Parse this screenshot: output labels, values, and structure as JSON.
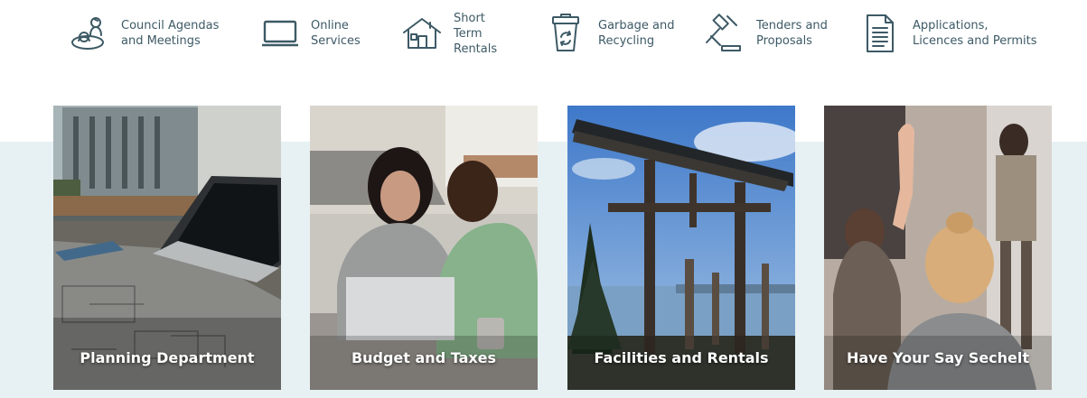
{
  "quick_links": [
    {
      "label": "Council Agendas\nand Meetings",
      "icon": "council-icon"
    },
    {
      "label": "Online\nServices",
      "icon": "laptop-icon"
    },
    {
      "label": "Short\nTerm\nRentals",
      "icon": "house-icon"
    },
    {
      "label": "Garbage and\nRecycling",
      "icon": "garbage-bin-icon"
    },
    {
      "label": "Tenders and\nProposals",
      "icon": "gavel-icon"
    },
    {
      "label": "Applications,\nLicences and Permits",
      "icon": "document-icon"
    }
  ],
  "cards": [
    {
      "label": "Planning Department"
    },
    {
      "label": "Budget and Taxes"
    },
    {
      "label": "Facilities and Rentals"
    },
    {
      "label": "Have Your Say Sechelt"
    }
  ],
  "colors": {
    "icon": "#3d5a66",
    "band": "#e7f1f3",
    "card_text": "#ffffff"
  }
}
